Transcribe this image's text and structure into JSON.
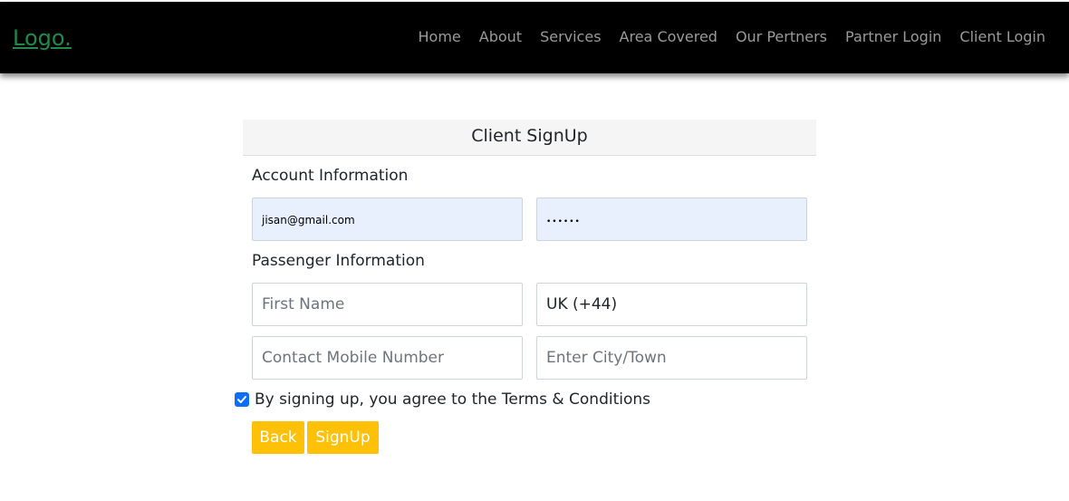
{
  "nav": {
    "logo": "Logo.",
    "links": [
      "Home",
      "About",
      "Services",
      "Area Covered",
      "Our Pertners",
      "Partner Login",
      "Client Login"
    ]
  },
  "form": {
    "title": "Client SignUp",
    "account_section": "Account Information",
    "email_value": "jisan@gmail.com",
    "password_value": "••••••",
    "passenger_section": "Passenger Information",
    "first_name_placeholder": "First Name",
    "country_code_value": "UK (+44)",
    "mobile_placeholder": "Contact Mobile Number",
    "city_placeholder": "Enter City/Town",
    "terms_text": "By signing up, you agree to the Terms & Conditions",
    "terms_checked": true,
    "back_label": "Back",
    "signup_label": "SignUp"
  },
  "colors": {
    "navbar": "#000000",
    "logo": "#1f8a4c",
    "button": "#ffc107",
    "checkbox": "#0d6efd",
    "autofill": "#e8f0fe"
  }
}
